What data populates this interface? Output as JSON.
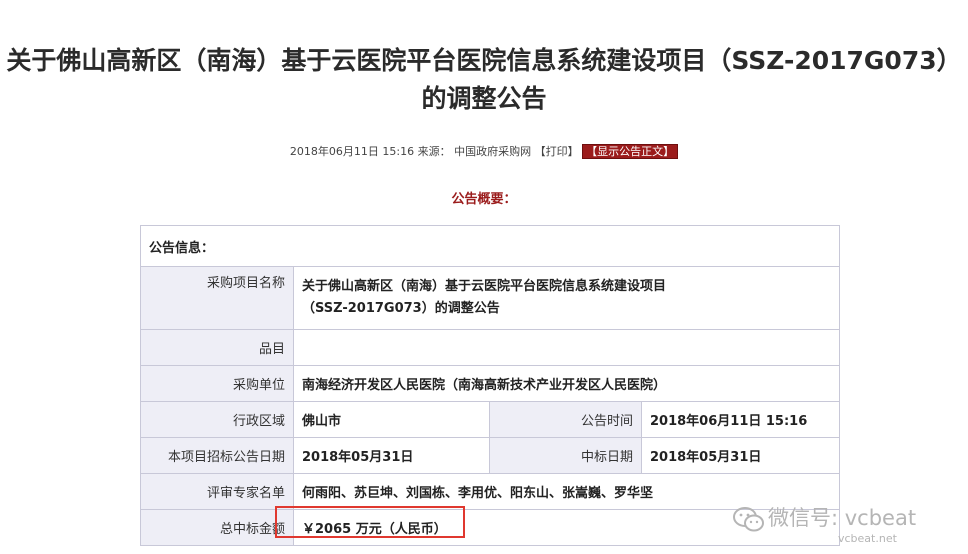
{
  "header": {
    "title_line1": "关于佛山高新区（南海）基于云医院平台医院信息系统建设项目（SSZ-2017G073）",
    "title_line2": "的调整公告"
  },
  "meta": {
    "date": "2018年06月11日 15:16",
    "source_label": "来源：",
    "source": "中国政府采购网",
    "print_label": "【打印】",
    "show_notice_label": "【显示公告正文】"
  },
  "summary_label": "公告概要：",
  "table": {
    "info_header": "公告信息：",
    "project_name_label": "采购项目名称",
    "project_name_line1": "关于佛山高新区（南海）基于云医院平台医院信息系统建设项目",
    "project_name_line2": "（SSZ-2017G073）的调整公告",
    "item_label": "品目",
    "item_value": "",
    "purchaser_label": "采购单位",
    "purchaser_value": "南海经济开发区人民医院（南海高新技术产业开发区人民医院）",
    "region_label": "行政区域",
    "region_value": "佛山市",
    "notice_time_label": "公告时间",
    "notice_time_value": "2018年06月11日 15:16",
    "bid_date_label": "本项目招标公告日期",
    "bid_date_value": "2018年05月31日",
    "award_date_label": "中标日期",
    "award_date_value": "2018年05月31日",
    "experts_label": "评审专家名单",
    "experts_value": "何雨阳、苏巨坤、刘国栋、李用优、阳东山、张嵩巍、罗华坚",
    "amount_label": "总中标金额",
    "amount_value": "￥2065 万元（人民币）"
  },
  "watermark": {
    "text": "微信号: vcbeat",
    "sub": "vcbeat.net"
  },
  "colors": {
    "accent_red": "#9b1c1c",
    "highlight_box": "#e0382f",
    "label_bg": "#eeeef6"
  }
}
